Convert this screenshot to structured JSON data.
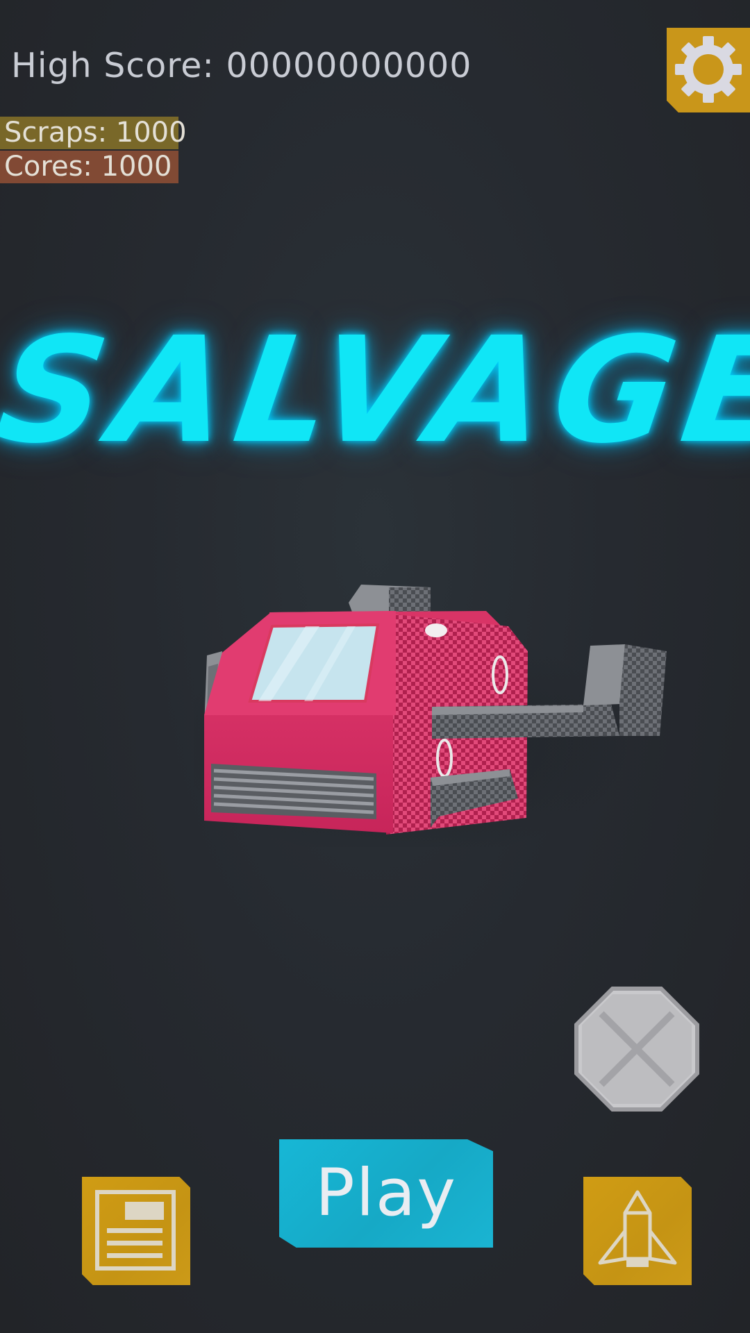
{
  "hud": {
    "high_score": "High Score: 00000000000",
    "scraps": "Scraps: 1000",
    "cores": "Cores: 1000"
  },
  "title": "SALVAGER",
  "buttons": {
    "play": "Play",
    "settings_icon": "gear-icon",
    "cancel_icon": "x-icon",
    "log_icon": "document-icon",
    "ship_icon": "rocket-icon"
  },
  "colors": {
    "title": "#10e6f6",
    "play_button": "#17b2d0",
    "yellow_button": "#c9961a",
    "ship_body": "#d42a63"
  }
}
